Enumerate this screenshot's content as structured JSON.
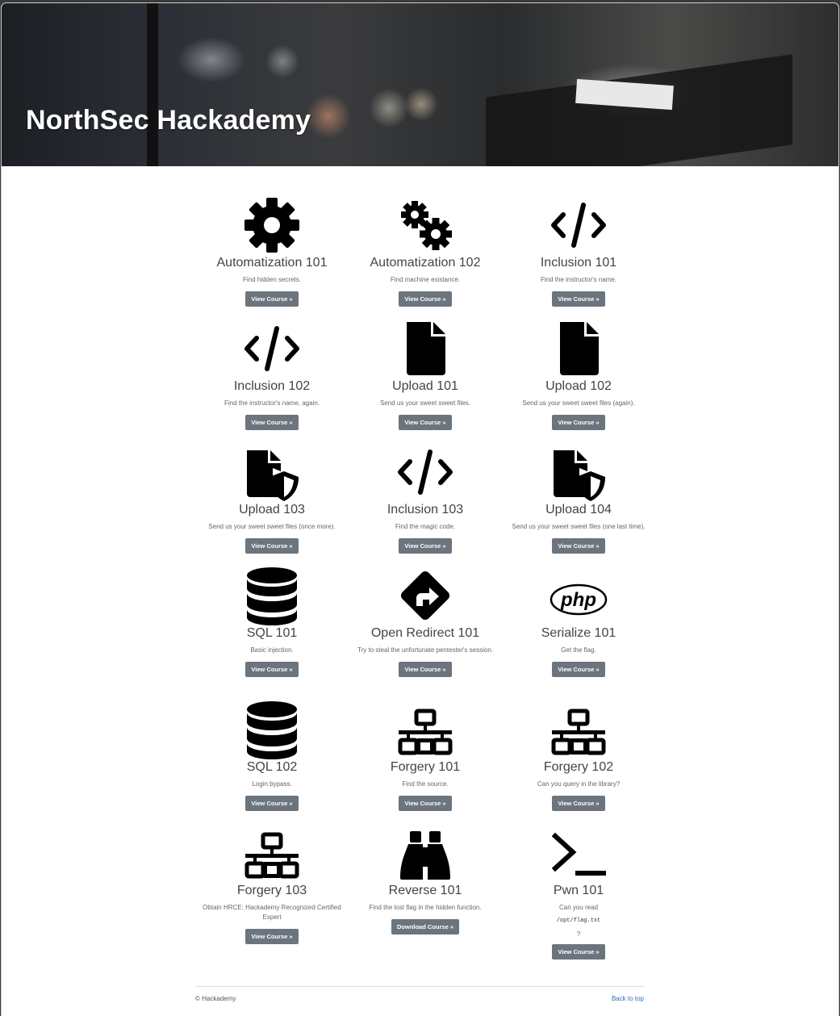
{
  "header": {
    "title": "NorthSec Hackademy"
  },
  "courses": [
    {
      "title": "Automatization 101",
      "desc": "Find hidden secrets.",
      "button": "View Course »",
      "icon": "gear-icon"
    },
    {
      "title": "Automatization 102",
      "desc": "Find machine existance.",
      "button": "View Course »",
      "icon": "gears-icon"
    },
    {
      "title": "Inclusion 101",
      "desc": "Find the instructor's name.",
      "button": "View Course »",
      "icon": "code-icon"
    },
    {
      "title": "Inclusion 102",
      "desc": "Find the instructor's name, again.",
      "button": "View Course »",
      "icon": "code-icon"
    },
    {
      "title": "Upload 101",
      "desc": "Send us your sweet sweet files.",
      "button": "View Course »",
      "icon": "file-icon"
    },
    {
      "title": "Upload 102",
      "desc": "Send us your sweet sweet files (again).",
      "button": "View Course »",
      "icon": "file-icon"
    },
    {
      "title": "Upload 103",
      "desc": "Send us your sweet sweet files (once more).",
      "button": "View Course »",
      "icon": "file-shield-icon"
    },
    {
      "title": "Inclusion 103",
      "desc": "Find the magic code.",
      "button": "View Course »",
      "icon": "code-icon"
    },
    {
      "title": "Upload 104",
      "desc": "Send us your sweet sweet files (one last time).",
      "button": "View Course »",
      "icon": "file-shield-icon"
    },
    {
      "title": "SQL 101",
      "desc": "Basic injection.",
      "button": "View Course »",
      "icon": "database-icon"
    },
    {
      "title": "Open Redirect 101",
      "desc": "Try to steal the unfortunate pentester's session.",
      "button": "View Course »",
      "icon": "directions-icon"
    },
    {
      "title": "Serialize 101",
      "desc": "Get the flag.",
      "button": "View Course »",
      "icon": "php-icon"
    },
    {
      "title": "SQL 102",
      "desc": "Login bypass.",
      "button": "View Course »",
      "icon": "database-icon"
    },
    {
      "title": "Forgery 101",
      "desc": "Find the source.",
      "button": "View Course »",
      "icon": "network-icon"
    },
    {
      "title": "Forgery 102",
      "desc": "Can you query in the library?",
      "button": "View Course »",
      "icon": "network-icon"
    },
    {
      "title": "Forgery 103",
      "desc": "Obtain HRCE: Hackademy Recognized Certified Expert",
      "button": "View Course »",
      "icon": "network-icon"
    },
    {
      "title": "Reverse 101",
      "desc": "Find the lost flag in the hidden function.",
      "button": "Download Course »",
      "icon": "binoculars-icon"
    },
    {
      "title": "Pwn 101",
      "desc": "Can you read",
      "code": "/opt/flag.txt",
      "q": "?",
      "button": "View Course »",
      "icon": "terminal-icon"
    }
  ],
  "footer": {
    "copyright": "© Hackademy",
    "back_to_top": "Back to top"
  }
}
